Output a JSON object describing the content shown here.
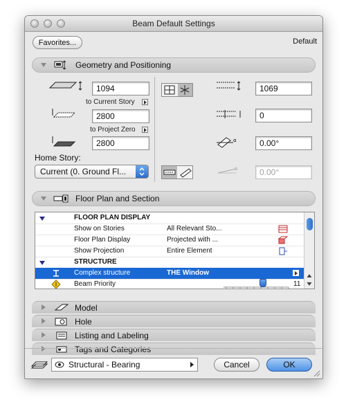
{
  "window": {
    "title": "Beam Default Settings"
  },
  "top": {
    "favorites_label": "Favorites...",
    "default_label": "Default"
  },
  "geometry": {
    "header": "Geometry and Positioning",
    "height_value": "1094",
    "to_current_story": "to Current Story",
    "offset_value": "2800",
    "to_project_zero": "to Project Zero",
    "elevation_value": "2800",
    "home_story_label": "Home Story:",
    "home_story_value": "Current (0. Ground Fl...",
    "width_value": "1069",
    "offset2_value": "0",
    "angle_value": "0.00°",
    "slant_value": "0.00°"
  },
  "floorplan": {
    "header": "Floor Plan and Section",
    "rows": [
      {
        "kind": "group",
        "label": "FLOOR PLAN DISPLAY",
        "value": ""
      },
      {
        "kind": "item",
        "label": "Show on Stories",
        "value": "All Relevant Sto..."
      },
      {
        "kind": "item",
        "label": "Floor Plan Display",
        "value": "Projected with ..."
      },
      {
        "kind": "item",
        "label": "Show Projection",
        "value": "Entire Element"
      },
      {
        "kind": "group",
        "label": "STRUCTURE",
        "value": ""
      },
      {
        "kind": "item",
        "label": "Complex structure",
        "value": "THE Window"
      },
      {
        "kind": "item",
        "label": "Beam Priority",
        "value": "11"
      }
    ]
  },
  "sections": [
    {
      "label": "Model"
    },
    {
      "label": "Hole"
    },
    {
      "label": "Listing and Labeling"
    },
    {
      "label": "Tags and Categories"
    }
  ],
  "footer": {
    "layer_value": "Structural - Bearing",
    "cancel_label": "Cancel",
    "ok_label": "OK"
  },
  "colors": {
    "selection": "#1a68d3",
    "accent": "#2e6fcf"
  }
}
